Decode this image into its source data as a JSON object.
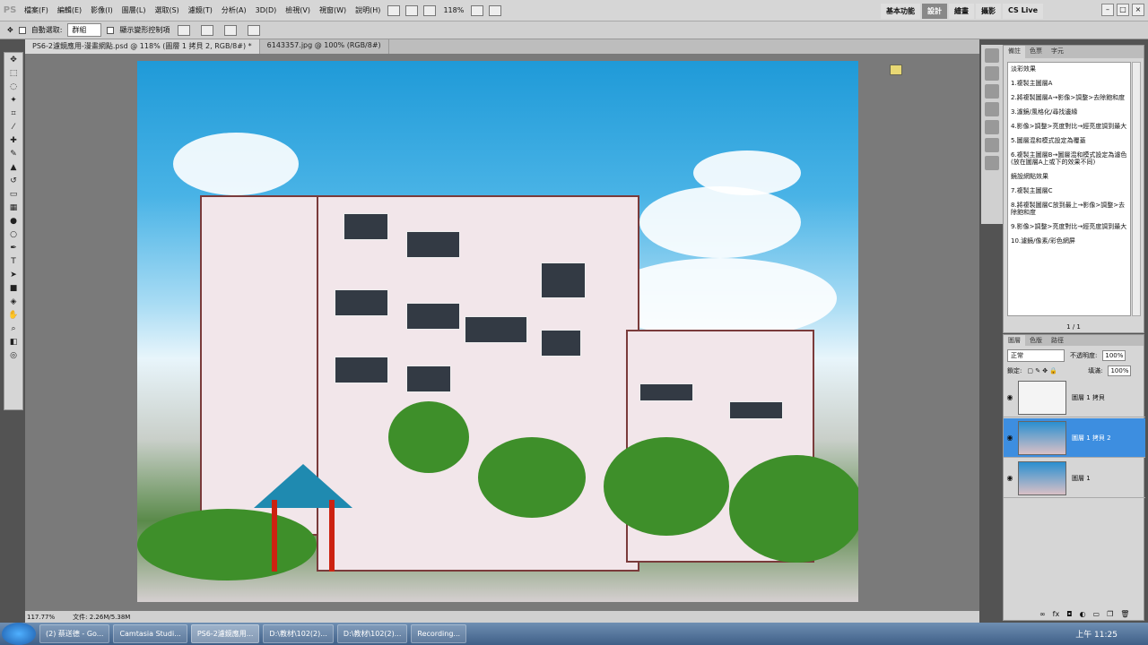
{
  "menubar": {
    "app_icon": "PS",
    "items": [
      "檔案(F)",
      "編輯(E)",
      "影像(I)",
      "圖層(L)",
      "選取(S)",
      "濾鏡(T)",
      "分析(A)",
      "3D(D)",
      "檢視(V)",
      "視窗(W)",
      "說明(H)"
    ],
    "zoom": "118%",
    "workspaces": [
      "基本功能",
      "設計",
      "繪畫",
      "攝影"
    ],
    "active_workspace": "設計",
    "cslive": "CS Live"
  },
  "options": {
    "auto_select_label": "自動選取:",
    "auto_select_value": "群組",
    "show_transform_label": "顯示變形控制項"
  },
  "tabs": [
    {
      "label": "PS6-2濾鏡應用-漫畫網點.psd @ 118% (圖層 1 拷貝 2, RGB/8#) *",
      "active": true
    },
    {
      "label": "6143357.jpg @ 100% (RGB/8#)",
      "active": false
    }
  ],
  "status": {
    "zoom": "117.77%",
    "doc": "文件: 2.26M/5.38M"
  },
  "notes": {
    "tabs": [
      "備註",
      "色票",
      "字元"
    ],
    "lines": [
      "淡彩效果",
      "1.複製主圖層A",
      "2.將複製圖層A→影像>調整>去除飽和度",
      "3.濾鏡/風格化/尋找邊緣",
      "4.影像>調整>亮度對比→經亮度調到最大",
      "5.圖層混和模式設定為覆蓋",
      "6.複製主圖層B→圖層混和模式設定為濾色(放在圖層A上或下的效果不同)",
      "鏡設網點效果",
      "7.複製主圖層C",
      "8.將複製圖層C放到最上→影像>調整>去除飽和度",
      "9.影像>調整>亮度對比→經亮度調到最大",
      "10.濾鏡/像素/彩色網屏"
    ],
    "page": "1 / 1"
  },
  "layers": {
    "tabs": [
      "圖層",
      "色版",
      "路徑"
    ],
    "blend": "正常",
    "opacity_label": "不透明度:",
    "opacity": "100%",
    "lock_label": "鎖定:",
    "fill_label": "填滿:",
    "fill": "100%",
    "items": [
      {
        "name": "圖層 1 拷貝",
        "selected": false
      },
      {
        "name": "圖層 1 拷貝 2",
        "selected": true
      },
      {
        "name": "圖層 1",
        "selected": false
      }
    ]
  },
  "taskbar": {
    "items": [
      "(2) 蔡送德 - Go...",
      "Camtasia Studi...",
      "PS6-2濾鏡應用...",
      "D:\\教材\\102(2)...",
      "D:\\教材\\102(2)...",
      "Recording..."
    ],
    "active": "PS6-2濾鏡應用...",
    "clock": "上午 11:25"
  }
}
